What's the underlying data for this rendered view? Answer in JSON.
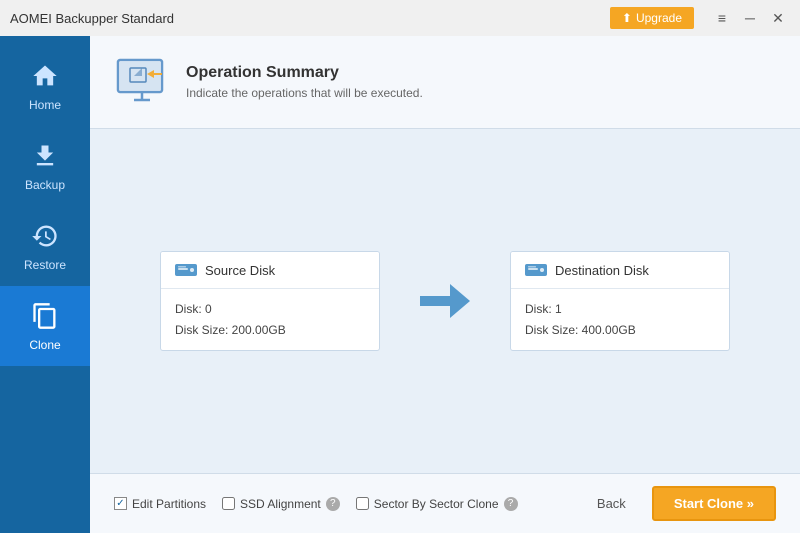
{
  "titlebar": {
    "title": "AOMEI Backupper Standard",
    "upgrade_label": "Upgrade",
    "menu_label": "≡",
    "minimize_label": "─",
    "close_label": "✕"
  },
  "sidebar": {
    "items": [
      {
        "id": "home",
        "label": "Home",
        "active": false
      },
      {
        "id": "backup",
        "label": "Backup",
        "active": false
      },
      {
        "id": "restore",
        "label": "Restore",
        "active": false
      },
      {
        "id": "clone",
        "label": "Clone",
        "active": true
      }
    ]
  },
  "header": {
    "title": "Operation Summary",
    "subtitle": "Indicate the operations that will be executed."
  },
  "source_disk": {
    "title": "Source Disk",
    "disk_num": "Disk: 0",
    "disk_size": "Disk Size: 200.00GB"
  },
  "dest_disk": {
    "title": "Destination Disk",
    "disk_num": "Disk: 1",
    "disk_size": "Disk Size: 400.00GB"
  },
  "footer": {
    "edit_partitions_label": "Edit Partitions",
    "ssd_alignment_label": "SSD Alignment",
    "sector_by_sector_label": "Sector By Sector Clone",
    "back_label": "Back",
    "start_clone_label": "Start Clone »"
  }
}
